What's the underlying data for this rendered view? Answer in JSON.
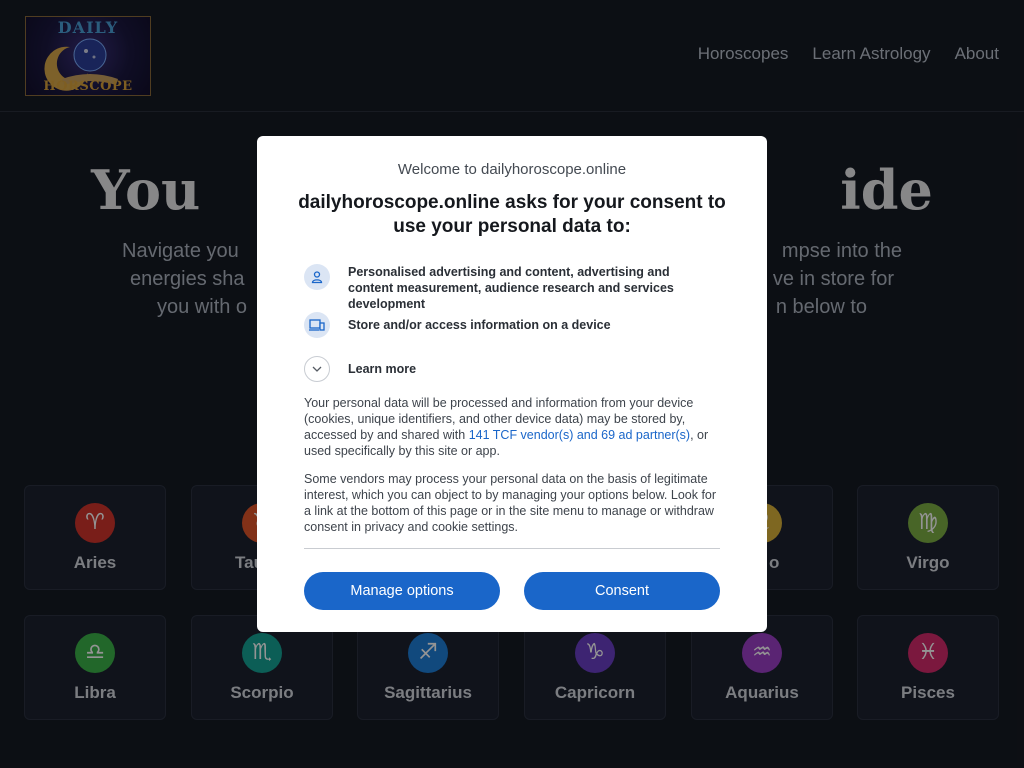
{
  "site": {
    "logo_top": "DAILY",
    "logo_bottom": "HORSCOPE"
  },
  "nav": {
    "items": [
      "Horoscopes",
      "Learn Astrology",
      "About"
    ]
  },
  "hero": {
    "title_left": "You",
    "title_right": "ide",
    "sub_lines": [
      {
        "left": "Navigate you",
        "right": "mpse into the"
      },
      {
        "left": "energies sha",
        "right": "ve in store for"
      },
      {
        "left": "you with o",
        "right": "n below to"
      }
    ]
  },
  "signs": [
    {
      "label": "Aries",
      "glyph": "♈",
      "color": "#d0342c"
    },
    {
      "label": "Tau",
      "glyph": "♉",
      "color": "#e0552a"
    },
    {
      "label": "",
      "glyph": "",
      "color": "#1c2130"
    },
    {
      "label": "",
      "glyph": "",
      "color": "#1c2130"
    },
    {
      "label": "o",
      "glyph": "♌",
      "color": "#d9b13a"
    },
    {
      "label": "Virgo",
      "glyph": "♍",
      "color": "#7cae44"
    },
    {
      "label": "Libra",
      "glyph": "♎",
      "color": "#3bb249"
    },
    {
      "label": "Scorpio",
      "glyph": "♏",
      "color": "#16a394"
    },
    {
      "label": "Sagittarius",
      "glyph": "♐",
      "color": "#1e7ed8"
    },
    {
      "label": "Capricorn",
      "glyph": "♑",
      "color": "#6a3fc4"
    },
    {
      "label": "Aquarius",
      "glyph": "♒",
      "color": "#9b3fc7"
    },
    {
      "label": "Pisces",
      "glyph": "♓",
      "color": "#d52a6c"
    }
  ],
  "consent": {
    "welcome": "Welcome to dailyhoroscope.online",
    "heading": "dailyhoroscope.online asks for your consent to use your personal data to:",
    "purposes": [
      {
        "icon": "person-icon",
        "text": "Personalised advertising and content, advertising and content measurement, audience research and services development"
      },
      {
        "icon": "devices-icon",
        "text": "Store and/or access information on a device"
      }
    ],
    "learn_more": "Learn more",
    "para1_before": "Your personal data will be processed and information from your device (cookies, unique identifiers, and other device data) may be stored by, accessed by and shared with ",
    "para1_link": "141 TCF vendor(s) and 69 ad partner(s)",
    "para1_after": ", or used specifically by this site or app.",
    "para2": "Some vendors may process your personal data on the basis of legitimate interest, which you can object to by managing your options below. Look for a link at the bottom of this page or in the site menu to manage or withdraw consent in privacy and cookie settings.",
    "manage_label": "Manage options",
    "consent_label": "Consent"
  },
  "colors": {
    "accent": "#1a66c9",
    "background": "#161a23"
  }
}
